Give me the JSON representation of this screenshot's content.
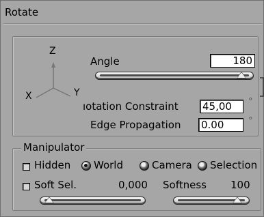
{
  "panel": {
    "title": "Rotate"
  },
  "axes": {
    "z": "Z",
    "x": "X",
    "y": "Y"
  },
  "angle": {
    "label": "Angle",
    "value": "180",
    "slider_fraction": 1.0
  },
  "rotation_constraint": {
    "label": "Rotation Constraint",
    "visible_label": "ıotation Constraint",
    "value": "45,00",
    "unit": "°"
  },
  "edge_propagation": {
    "label": "Edge Propagation",
    "value": "0.00",
    "unit": "°"
  },
  "manipulator": {
    "legend": "Manipulator",
    "hidden_label": "Hidden",
    "world_label": "World",
    "camera_label": "Camera",
    "selection_label": "Selection",
    "selected_mode": "World",
    "soft_sel_label": "Soft Sel.",
    "soft_sel_value": "0,000",
    "softness_label": "Softness",
    "softness_value": "100"
  }
}
